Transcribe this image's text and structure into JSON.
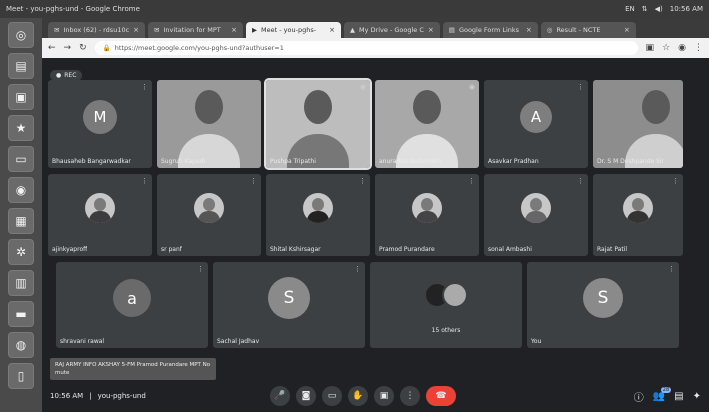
{
  "os": {
    "title": "Meet - you-pghs-und - Google Chrome",
    "tray": [
      "EN",
      "⇅",
      "◀)",
      "10:56 AM"
    ]
  },
  "launcher": [
    "chromium-icon",
    "files-icon",
    "terminal-icon",
    "star-icon",
    "folder-icon",
    "settings-icon",
    "document-icon",
    "gear-icon",
    "calc-icon",
    "drive-icon",
    "chrome-icon",
    "trash-icon"
  ],
  "tabs": [
    {
      "label": "Inbox (62) - rdsu10c",
      "active": false
    },
    {
      "label": "Invitation for MPT",
      "active": false
    },
    {
      "label": "Meet - you-pghs-",
      "active": true
    },
    {
      "label": "My Drive - Google C",
      "active": false
    },
    {
      "label": "Google Form Links",
      "active": false
    },
    {
      "label": "Result - NCTE",
      "active": false
    }
  ],
  "address": {
    "url": "https://meet.google.com/you-pghs-und?authuser=1"
  },
  "meet": {
    "pill": "REC",
    "row1": [
      {
        "name": "Bhausaheb Bangarwadkar",
        "type": "letter",
        "letter": "M",
        "color": "#7a7a7a"
      },
      {
        "name": "Sugruti Kapadi",
        "type": "video"
      },
      {
        "name": "Pushpa Tripathi",
        "type": "video",
        "highlight": true
      },
      {
        "name": "anuradha deshmukh",
        "type": "video"
      },
      {
        "name": "Asavkar Pradhan",
        "type": "letter",
        "letter": "A",
        "color": "#7e7e7e"
      },
      {
        "name": "Dr. S M Deshpande Sir",
        "type": "video"
      }
    ],
    "row2": [
      {
        "name": "ajinkyaproff",
        "type": "photo"
      },
      {
        "name": "sr panf",
        "type": "photo"
      },
      {
        "name": "Shital Kshirsagar",
        "type": "photo"
      },
      {
        "name": "Pramod Purandare",
        "type": "photo"
      },
      {
        "name": "sonal Ambashi",
        "type": "photo"
      },
      {
        "name": "Rajat Patil",
        "type": "photo"
      }
    ],
    "row3": [
      {
        "name": "shravani rawal",
        "type": "letter",
        "letter": "a",
        "color": "#6a6a6a"
      },
      {
        "name": "Sachal Jadhav",
        "type": "letter",
        "letter": "S",
        "color": "#8a8a8a"
      },
      {
        "name": "15 others",
        "type": "group"
      },
      {
        "name": "You",
        "type": "letter",
        "letter": "S",
        "color": "#8a8a8a"
      }
    ],
    "banner": "RAJ ARMY INFO AKSHAY 5-FM Pramod Purandare MPT No mute"
  },
  "bottom": {
    "time": "10:56 AM",
    "sep": "|",
    "code": "you-pghs-und",
    "people_count": "28"
  }
}
